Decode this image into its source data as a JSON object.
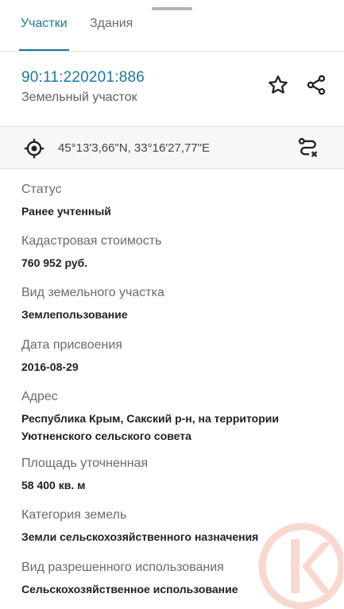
{
  "tabs": [
    {
      "label": "Участки"
    },
    {
      "label": "Здания"
    }
  ],
  "parcel": {
    "cadastral_number": "90:11:220201:886",
    "type": "Земельный участок",
    "coordinates": "45°13'3,66\"N, 33°16'27,77\"E"
  },
  "fields": [
    {
      "label": "Статус",
      "value": "Ранее учтенный"
    },
    {
      "label": "Кадастровая стоимость",
      "value": "760 952 руб."
    },
    {
      "label": "Вид земельного участка",
      "value": "Землепользование"
    },
    {
      "label": "Дата присвоения",
      "value": "2016-08-29"
    },
    {
      "label": "Адрес",
      "value_line1": "Республика Крым, Сакский р-н, на территории",
      "value_line2": "Уютненского сельского совета"
    },
    {
      "label": "Площадь уточненная",
      "value": "58 400 кв. м"
    },
    {
      "label": "Категория земель",
      "value": "Земли сельскохозяйственного назначения"
    },
    {
      "label": "Вид разрешенного использования",
      "value": "Сельскохозяйственное использование"
    }
  ],
  "colors": {
    "accent": "#1a7a9a",
    "watermark": "#e8502a"
  },
  "icons": [
    "star-icon",
    "share-icon",
    "target-icon",
    "route-icon",
    "logo-watermark"
  ]
}
